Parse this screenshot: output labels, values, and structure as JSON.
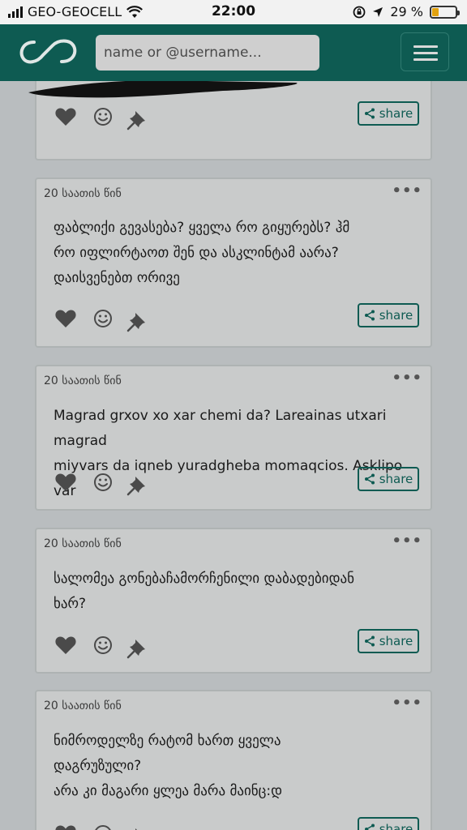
{
  "status_bar": {
    "carrier": "GEO-GEOCELL",
    "time": "22:00",
    "battery_percent": "29 %",
    "battery_level": 0.29,
    "battery_color": "#e2a20f"
  },
  "header": {
    "logo_icon": "infinity-logo-icon",
    "search_placeholder": "name or @username...",
    "menu_icon": "hamburger-menu-icon",
    "accent_color": "#0e5b52"
  },
  "posts": [
    {
      "time": "",
      "text": "",
      "share_label": "share"
    },
    {
      "time": "20 საათის წინ",
      "text": "ფაბლიქი გევასება? ყველა რო გიყურებს? ჰმ\nრო იფლირტაოთ შენ და ასკლინტამ აარა?\nდაისვენებთ ორივე",
      "share_label": "share"
    },
    {
      "time": "20 საათის წინ",
      "text": "Magrad grxov xo xar chemi da? Lareainas utxari magrad\nmiyvars da iqneb yuradgheba momaqcios. Asklipo var",
      "share_label": "share"
    },
    {
      "time": "20 საათის წინ",
      "text": "სალომეა გონებაჩამორჩენილი დაბადებიდან\nხარ?",
      "share_label": "share"
    },
    {
      "time": "20 საათის წინ",
      "text": "ნიმროდელზე რატომ ხართ ყველა\nდაგრუზული?\nარა კი მაგარი ყლეა მარა მაინც:დ",
      "share_label": "share"
    }
  ],
  "icons": {
    "like": "heart-icon",
    "reaction": "smiley-icon",
    "pin": "pin-icon",
    "share": "share-icon",
    "more": "more-dots-icon"
  }
}
